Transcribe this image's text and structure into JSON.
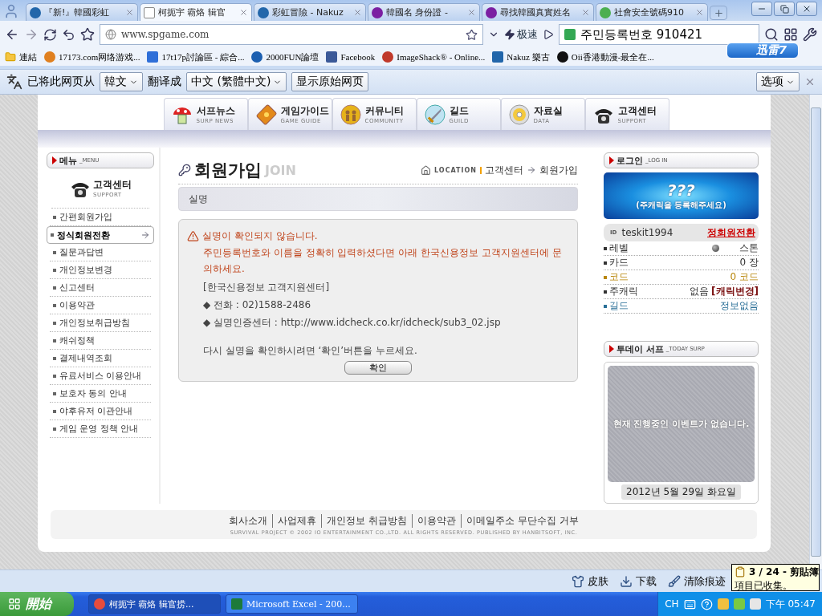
{
  "browser": {
    "tabs": [
      {
        "title": "『新!』韓國彩虹",
        "selected": false
      },
      {
        "title": "柯扼宇 霸烙 辑官",
        "selected": true
      },
      {
        "title": "彩虹冒險 - Nakuz",
        "selected": false
      },
      {
        "title": "韓國名 身份證 -",
        "selected": false
      },
      {
        "title": "尋找韓國真實姓名",
        "selected": false
      },
      {
        "title": "社會安全號碼910",
        "selected": false
      }
    ],
    "address": "www.spgame.com",
    "speed_button": "极速",
    "search": "주민등록번호 910421",
    "xunlei_badge": "迅雷7",
    "bookmarks": [
      "連結",
      "17173.com网络游戏...",
      "17t17p討論區 - 綜合...",
      "2000FUN論壇",
      "Facebook",
      "ImageShack® - Online...",
      "Nakuz 樂古",
      "Oii香港動漫-最全在..."
    ],
    "translate": {
      "from_label": "已将此网页从",
      "source": "韓文",
      "to_label": "翻译成",
      "target": "中文 (繁體中文)",
      "show_original": "显示原始网页",
      "options": "选项"
    }
  },
  "site": {
    "nav": [
      {
        "label": "서프뉴스",
        "sub": "SURP NEWS",
        "kind": "mushroom"
      },
      {
        "label": "게임가이드",
        "sub": "GAME GUIDE",
        "kind": "book"
      },
      {
        "label": "커뮤니티",
        "sub": "COMMUNITY",
        "kind": "people"
      },
      {
        "label": "길드",
        "sub": "GUILD",
        "kind": "sword"
      },
      {
        "label": "자료실",
        "sub": "DATA",
        "kind": "disc"
      },
      {
        "label": "고객센터",
        "sub": "SUPPORT",
        "kind": "phone"
      }
    ],
    "menu": {
      "title": "메뉴",
      "title_sub": "_MENU",
      "section": "고객센터",
      "section_sub": "SUPPORT",
      "items": [
        {
          "label": "간편회원가입",
          "selected": false
        },
        {
          "label": "정식회원전환",
          "selected": true
        },
        {
          "label": "질문과답변",
          "selected": false
        },
        {
          "label": "개인정보변경",
          "selected": false
        },
        {
          "label": "신고센터",
          "selected": false
        },
        {
          "label": "이용약관",
          "selected": false
        },
        {
          "label": "개인정보취급방침",
          "selected": false
        },
        {
          "label": "캐쉬정책",
          "selected": false
        },
        {
          "label": "결제내역조회",
          "selected": false
        },
        {
          "label": "유료서비스 이용안내",
          "selected": false
        },
        {
          "label": "보호자 동의 안내",
          "selected": false
        },
        {
          "label": "야후유저 이관안내",
          "selected": false
        },
        {
          "label": "게임 운영 정책 안내",
          "selected": false
        }
      ]
    },
    "content": {
      "title": "회원가입",
      "title_en": "JOIN",
      "location_label": "LOCATION",
      "breadcrumb": [
        "고객센터",
        "회원가입"
      ],
      "section": "실명",
      "error_title": "실명이 확인되지 않습니다.",
      "error_message": "주민등록번호와 이름을 정확히 입력하셨다면 아래 한국신용정보 고객지원센터에 문의하세요.",
      "info": [
        "[한국신용정보 고객지원센터]",
        "◆ 전화 : 02)1588-2486",
        "◆ 실명인증센터 : http://www.idcheck.co.kr/idcheck/sub3_02.jsp"
      ],
      "prompt": "다시 실명을 확인하시려면 ‘확인’버튼을 누르세요.",
      "button": "확인"
    },
    "login": {
      "title": "로그인",
      "title_sub": "_LOG IN",
      "banner_mark": "???",
      "banner_text": "(주캐릭을 등록해주세요)",
      "id_label": "ID",
      "user": "teskit1994",
      "action": "정회원전환",
      "stats": [
        {
          "label": "레벨",
          "value": "스톤",
          "color": "#333333",
          "kind": "level"
        },
        {
          "label": "카드",
          "value": "0 장",
          "color": "#333333",
          "kind": "plain"
        },
        {
          "label": "코드",
          "value": "0 코드",
          "color": "#b8860b",
          "kind": "plain"
        },
        {
          "label": "주캐릭",
          "value": "없음",
          "link": "[캐릭변경]",
          "color": "#333333",
          "kind": "link"
        },
        {
          "label": "길드",
          "value": "정보없음",
          "color": "#2a6f97",
          "kind": "plain"
        }
      ]
    },
    "today": {
      "title": "투데이 서프",
      "title_sub": "_TODAY SURP",
      "message": "현재 진행중인 이벤트가 없습니다.",
      "date": "2012년 5월 29일 화요일"
    },
    "footer": {
      "links": [
        "회사소개",
        "사업제휴",
        "개인정보 취급방침",
        "이용약관",
        "이메일주소 무단수집 거부"
      ],
      "copyright": "SURVIVAL PROJECT © 2002 IO ENTERTAINMENT CO.,LTD. ALL RIGHTS RESERVED. PUBLISHED BY HANBITSOFT, INC."
    }
  },
  "status_bar": {
    "items": [
      {
        "label": "皮肤",
        "kind": "skin"
      },
      {
        "label": "下载",
        "kind": "download"
      },
      {
        "label": "清除痕迹",
        "kind": "clean"
      }
    ],
    "clipboard": {
      "title": "3 / 24 - 剪貼簿",
      "text": "項目已收集。"
    }
  },
  "taskbar": {
    "start": "開始",
    "tasks": [
      {
        "title": "柯扼宇 霸烙 辑官捞...",
        "selected": true,
        "kind": "browser"
      },
      {
        "title": "Microsoft Excel - 200...",
        "selected": false,
        "kind": "excel"
      }
    ],
    "lang": "CH",
    "time": "下午 05:47"
  }
}
